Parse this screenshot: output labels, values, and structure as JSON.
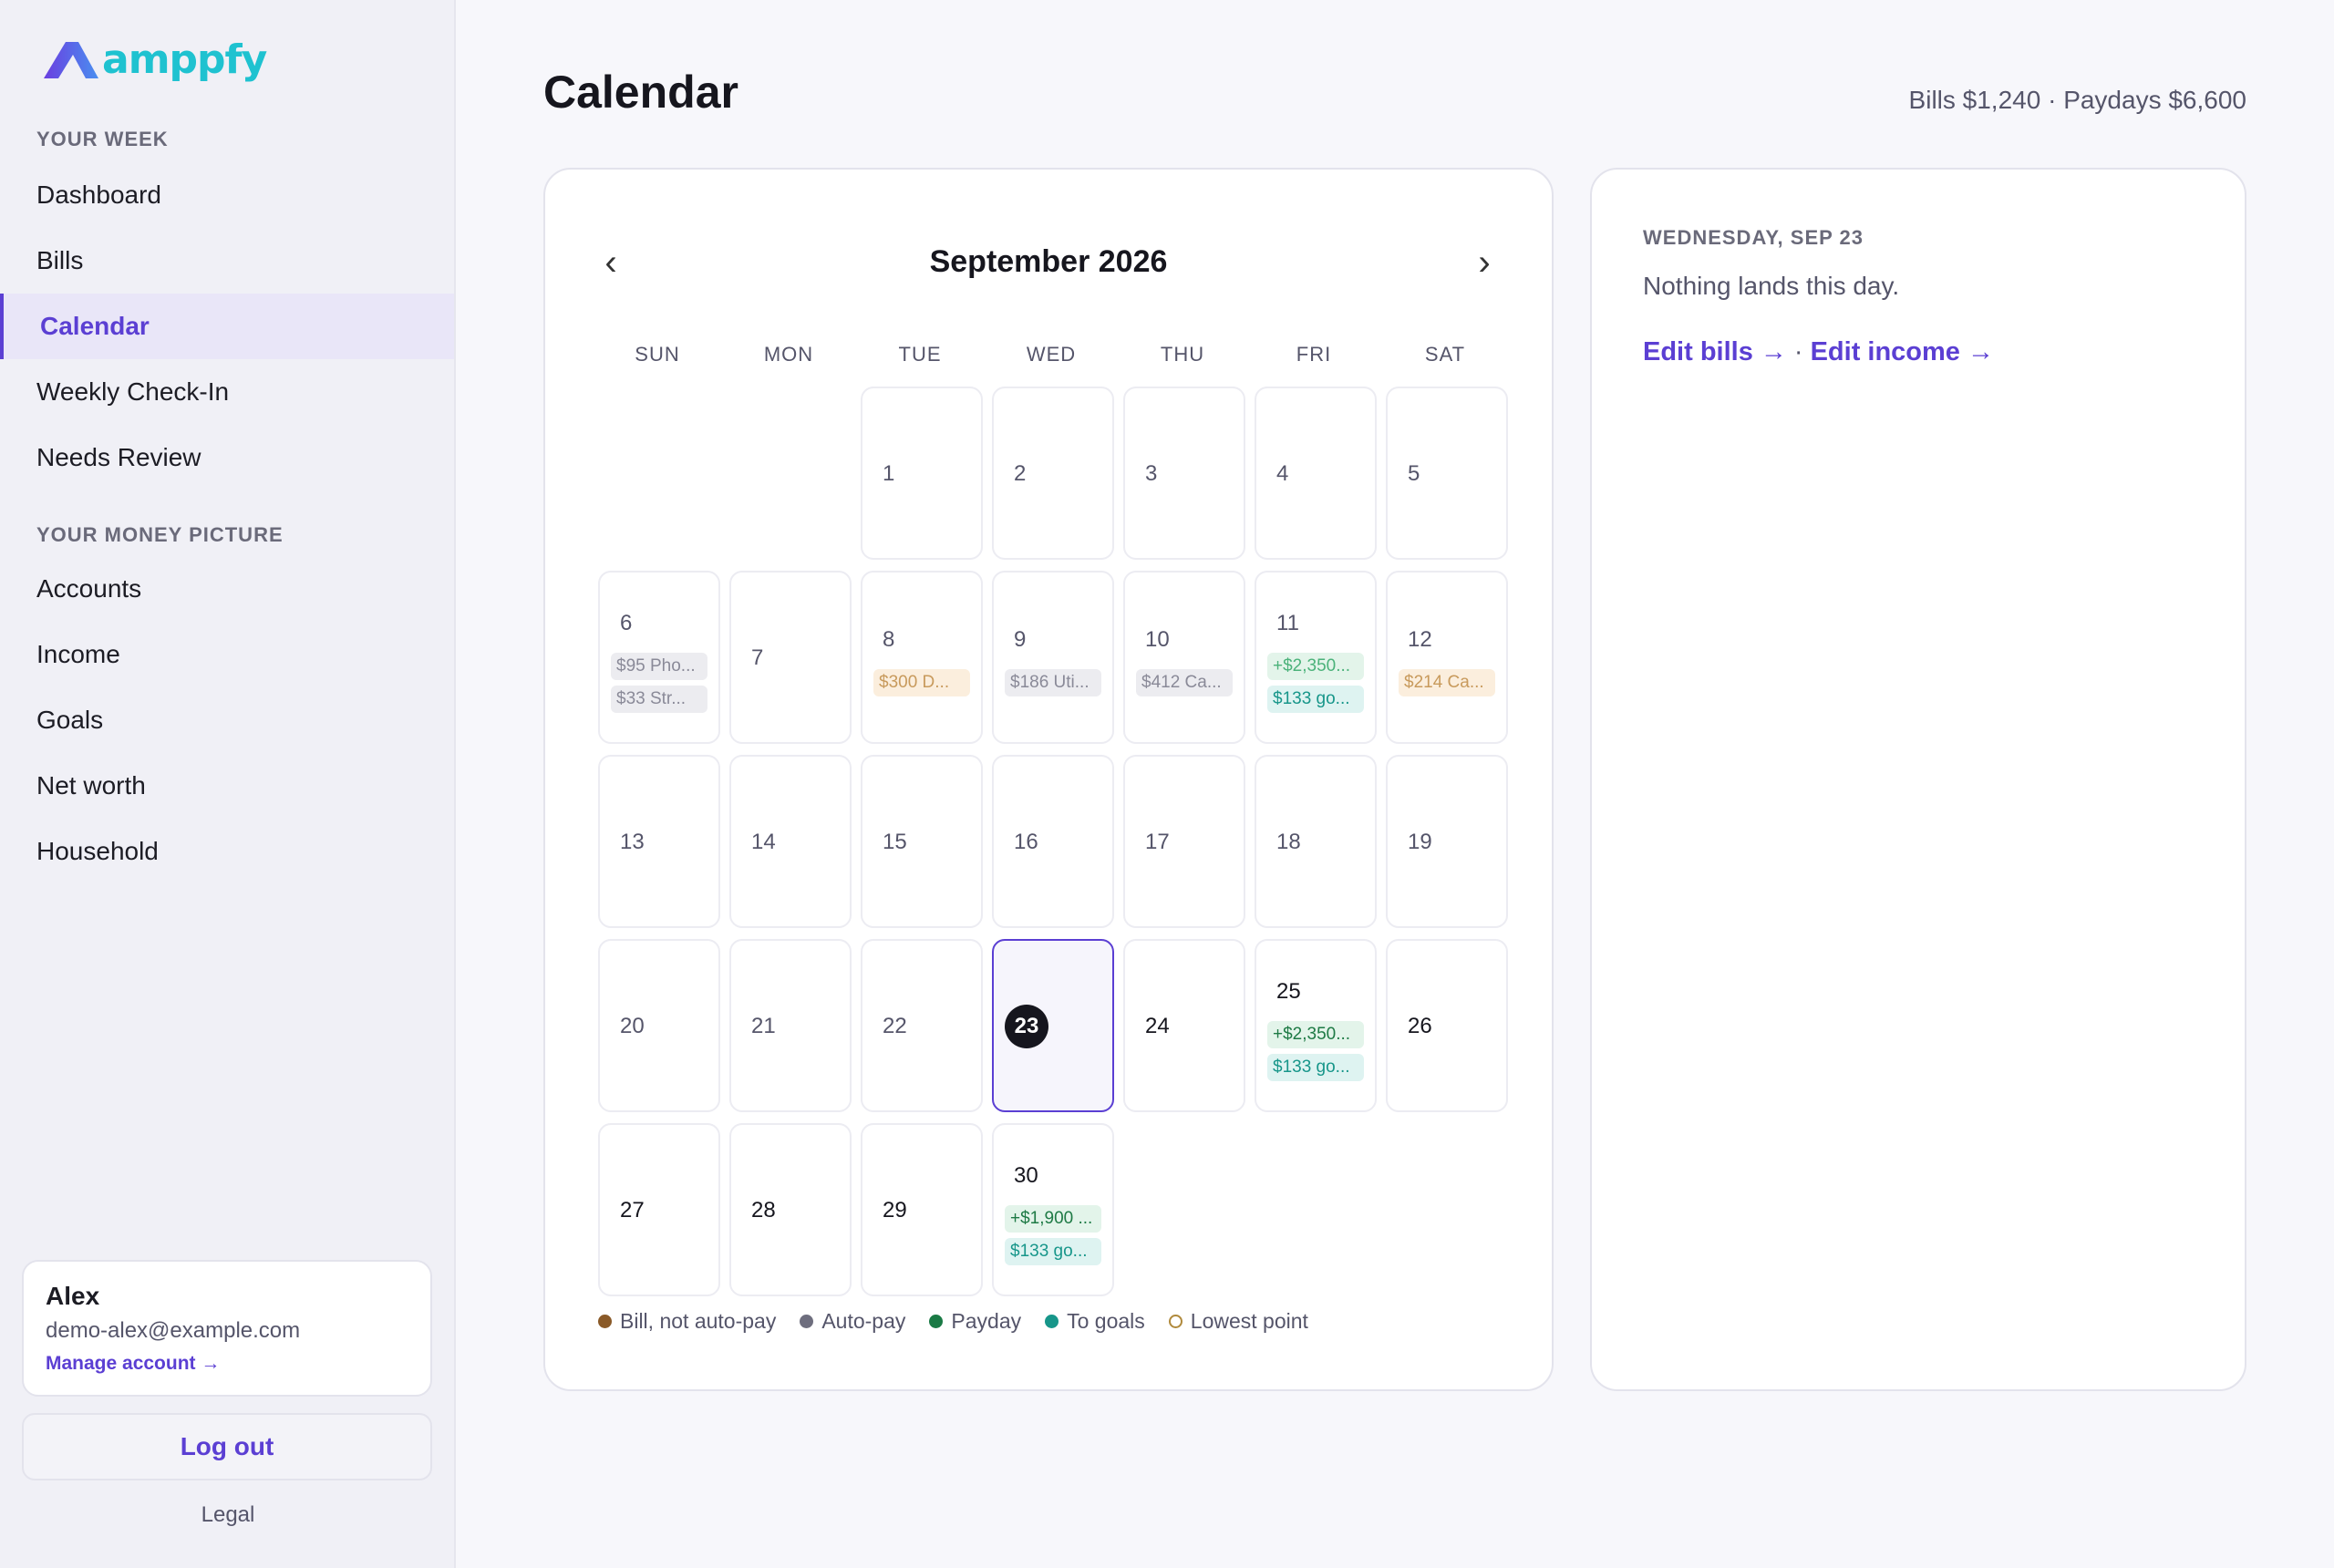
{
  "brand": {
    "name": "amppfy"
  },
  "page": {
    "title": "Calendar",
    "summary": "Bills $1,240 · Paydays $6,600"
  },
  "sidebar": {
    "sections": [
      {
        "label": "YOUR WEEK",
        "items": [
          "Dashboard",
          "Bills",
          "Calendar",
          "Weekly Check-In",
          "Needs Review"
        ]
      },
      {
        "label": "YOUR MONEY PICTURE",
        "items": [
          "Accounts",
          "Income",
          "Goals",
          "Net worth",
          "Household"
        ]
      }
    ],
    "active": "Calendar"
  },
  "account": {
    "name": "Alex",
    "email": "demo-alex@example.com",
    "manage": "Manage account →"
  },
  "logout": "Log out",
  "legal": "Legal",
  "calendar": {
    "month": "September 2026",
    "prev": "‹",
    "next": "›",
    "weekdays": [
      "SUN",
      "MON",
      "TUE",
      "WED",
      "THU",
      "FRI",
      "SAT"
    ],
    "leading_blanks": 2,
    "today": 23,
    "dark_from": 24,
    "days": [
      {
        "n": 1
      },
      {
        "n": 2
      },
      {
        "n": 3
      },
      {
        "n": 4
      },
      {
        "n": 5
      },
      {
        "n": 6,
        "chips": [
          {
            "t": "auto",
            "label": "$95 Pho..."
          },
          {
            "t": "auto",
            "label": "$33 Str..."
          }
        ]
      },
      {
        "n": 7
      },
      {
        "n": 8,
        "chips": [
          {
            "t": "bill",
            "label": "$300 D..."
          }
        ]
      },
      {
        "n": 9,
        "chips": [
          {
            "t": "auto",
            "label": "$186 Uti..."
          }
        ]
      },
      {
        "n": 10,
        "chips": [
          {
            "t": "auto",
            "label": "$412 Ca..."
          }
        ]
      },
      {
        "n": 11,
        "chips": [
          {
            "t": "payday",
            "label": "+$2,350..."
          },
          {
            "t": "goals",
            "label": "$133 go..."
          }
        ]
      },
      {
        "n": 12,
        "chips": [
          {
            "t": "bill",
            "label": "$214 Ca..."
          }
        ]
      },
      {
        "n": 13
      },
      {
        "n": 14
      },
      {
        "n": 15
      },
      {
        "n": 16
      },
      {
        "n": 17
      },
      {
        "n": 18
      },
      {
        "n": 19
      },
      {
        "n": 20
      },
      {
        "n": 21
      },
      {
        "n": 22
      },
      {
        "n": 23
      },
      {
        "n": 24
      },
      {
        "n": 25,
        "chips": [
          {
            "t": "payday",
            "label": "+$2,350..."
          },
          {
            "t": "goals",
            "label": "$133 go..."
          }
        ]
      },
      {
        "n": 26
      },
      {
        "n": 27
      },
      {
        "n": 28
      },
      {
        "n": 29
      },
      {
        "n": 30,
        "chips": [
          {
            "t": "payday",
            "label": "+$1,900 ..."
          },
          {
            "t": "goals",
            "label": "$133 go..."
          }
        ]
      }
    ],
    "legend": [
      {
        "label": "Bill, not auto-pay",
        "color": "#8a5a28",
        "hollow": false
      },
      {
        "label": "Auto-pay",
        "color": "#6e6e7e",
        "hollow": false
      },
      {
        "label": "Payday",
        "color": "#1a7a45",
        "hollow": false
      },
      {
        "label": "To goals",
        "color": "#17968a",
        "hollow": false
      },
      {
        "label": "Lowest point",
        "color": "#b08a3c",
        "hollow": true
      }
    ]
  },
  "detail": {
    "date": "WEDNESDAY, SEP 23",
    "message": "Nothing lands this day.",
    "edit_bills": "Edit bills →",
    "separator": "·",
    "edit_income": "Edit income →"
  }
}
